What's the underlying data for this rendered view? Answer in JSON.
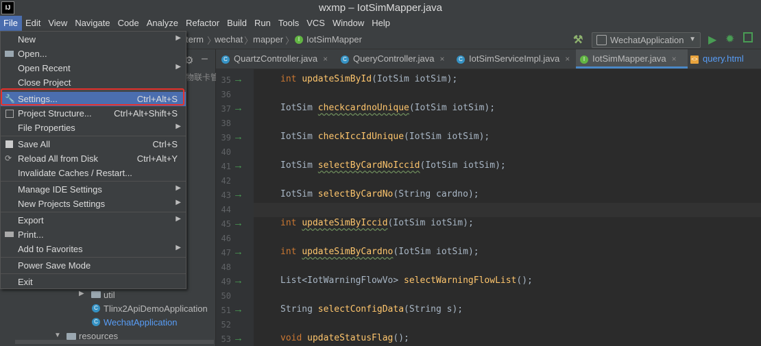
{
  "window": {
    "title": "wxmp – IotSimMapper.java",
    "logo": "IJ"
  },
  "menubar": [
    "File",
    "Edit",
    "View",
    "Navigate",
    "Code",
    "Analyze",
    "Refactor",
    "Build",
    "Run",
    "Tools",
    "VCS",
    "Window",
    "Help"
  ],
  "breadcrumb": [
    "term",
    "wechat",
    "mapper",
    "IotSimMapper"
  ],
  "run_config": {
    "label": "WechatApplication"
  },
  "tabs": [
    {
      "label": "QuartzController.java"
    },
    {
      "label": "QueryController.java"
    },
    {
      "label": "IotSimServiceImpl.java"
    },
    {
      "label": "IotSimMapper.java",
      "active": true
    },
    {
      "label": "query.html"
    }
  ],
  "project_tree": {
    "partial_label": "物联卡管",
    "util": "util",
    "tlinx": "Tlinx2ApiDemoApplication",
    "wechat_app": "WechatApplication",
    "resources": "resources"
  },
  "file_menu": {
    "new": "New",
    "open": "Open...",
    "open_recent": "Open Recent",
    "close_project": "Close Project",
    "settings": "Settings...",
    "settings_sc": "Ctrl+Alt+S",
    "project_structure": "Project Structure...",
    "project_structure_sc": "Ctrl+Alt+Shift+S",
    "file_properties": "File Properties",
    "save_all": "Save All",
    "save_all_sc": "Ctrl+S",
    "reload": "Reload All from Disk",
    "reload_sc": "Ctrl+Alt+Y",
    "invalidate": "Invalidate Caches / Restart...",
    "manage_ide": "Manage IDE Settings",
    "new_projects": "New Projects Settings",
    "export": "Export",
    "print": "Print...",
    "favorites": "Add to Favorites",
    "power_save": "Power Save Mode",
    "exit": "Exit"
  },
  "code_lines": [
    {
      "n": "35",
      "arrow": true,
      "type": "int",
      "name": "updateSimById",
      "args": "(IotSim iotSim);"
    },
    {
      "n": "36"
    },
    {
      "n": "37",
      "arrow": true,
      "type": "IotSim",
      "name": "checkcardnoUnique",
      "args": "(IotSim iotSim);"
    },
    {
      "n": "38"
    },
    {
      "n": "39",
      "arrow": true,
      "type": "IotSim",
      "name": "checkIccIdUnique",
      "args": "(IotSim iotSim);"
    },
    {
      "n": "40"
    },
    {
      "n": "41",
      "arrow": true,
      "type": "IotSim",
      "name": "selectByCardNoIccid",
      "args": "(IotSim iotSim);"
    },
    {
      "n": "42"
    },
    {
      "n": "43",
      "arrow": true,
      "type": "IotSim",
      "name": "selectByCardNo",
      "args": "(String cardno);"
    },
    {
      "n": "44"
    },
    {
      "n": "45",
      "arrow": true,
      "type": "int",
      "name": "updateSimByIccid",
      "args": "(IotSim iotSim);"
    },
    {
      "n": "46"
    },
    {
      "n": "47",
      "arrow": true,
      "type": "int",
      "name": "updateSimByCardno",
      "args": "(IotSim iotSim);"
    },
    {
      "n": "48"
    },
    {
      "n": "49",
      "arrow": true,
      "type": "List<IotWarningFlowVo>",
      "name": "selectWarningFlowList",
      "args": "();"
    },
    {
      "n": "50"
    },
    {
      "n": "51",
      "arrow": true,
      "type": "String",
      "name": "selectConfigData",
      "args": "(String s);"
    },
    {
      "n": "52"
    },
    {
      "n": "53",
      "arrow": true,
      "type": "void",
      "name": "updateStatusFlag",
      "args": "();"
    }
  ]
}
